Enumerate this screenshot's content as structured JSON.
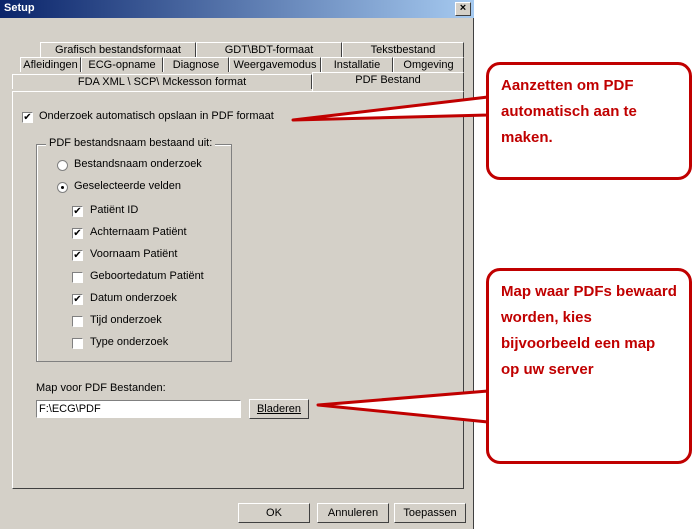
{
  "window": {
    "title": "Setup",
    "close_glyph": "×"
  },
  "tabs_row1": [
    "Grafisch bestandsformaat",
    "GDT\\BDT-formaat",
    "Tekstbestand"
  ],
  "tabs_row2": [
    "Afleidingen",
    "ECG-opname",
    "Diagnose",
    "Weergavemodus",
    "Installatie",
    "Omgeving"
  ],
  "tabs_row3": [
    "FDA XML \\ SCP\\ Mckesson format",
    "PDF Bestand"
  ],
  "pdf": {
    "auto_save_label": "Onderzoek automatisch opslaan in PDF formaat",
    "auto_save_checked": true,
    "group_title": "PDF bestandsnaam bestaand uit:",
    "radio_filename": "Bestandsnaam onderzoek",
    "radio_fields": "Geselecteerde velden",
    "fields": [
      {
        "label": "Patiënt ID",
        "checked": true
      },
      {
        "label": "Achternaam Patiënt",
        "checked": true
      },
      {
        "label": "Voornaam Patiënt",
        "checked": true
      },
      {
        "label": "Geboortedatum Patiënt",
        "checked": false
      },
      {
        "label": "Datum onderzoek",
        "checked": true
      },
      {
        "label": "Tijd onderzoek",
        "checked": false
      },
      {
        "label": "Type onderzoek",
        "checked": false
      }
    ],
    "folder_label": "Map voor PDF Bestanden:",
    "folder_value": "F:\\ECG\\PDF",
    "browse_label": "Bladeren"
  },
  "buttons": {
    "ok": "OK",
    "cancel": "Annuleren",
    "apply": "Toepassen"
  },
  "callouts": {
    "top_text": "Aanzetten om PDF automatisch aan te maken.",
    "bottom_text": "Map waar PDFs bewaard worden, kies bijvoorbeeld een map op uw server",
    "color": "#c00000"
  }
}
